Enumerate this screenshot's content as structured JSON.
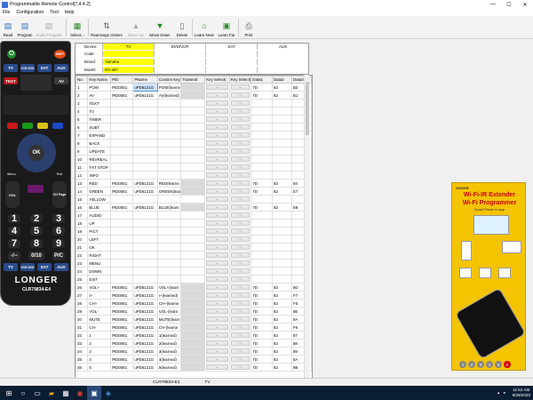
{
  "window": {
    "title": "Programmable Remote Control[7.4.4.2]",
    "minimize": "—",
    "maximize": "☐",
    "close": "✕"
  },
  "menu": [
    "File",
    "Configuration",
    "Tool",
    "Help"
  ],
  "toolbar": [
    {
      "label": "Read",
      "icon": "read-icon",
      "enabled": true
    },
    {
      "label": "Program",
      "icon": "program-icon",
      "enabled": true
    },
    {
      "label": "Audio Program",
      "icon": "audio-program-icon",
      "enabled": false
    },
    {
      "label": "Select...",
      "icon": "select-icon",
      "enabled": true
    },
    {
      "label": "Rearrange Orders",
      "icon": "rearrange-icon",
      "enabled": true
    },
    {
      "label": "Move Up",
      "icon": "move-up-icon",
      "enabled": false
    },
    {
      "label": "Move Down",
      "icon": "move-down-icon",
      "enabled": true
    },
    {
      "label": "Delete",
      "icon": "delete-icon",
      "enabled": true
    },
    {
      "label": "Learn Near",
      "icon": "learn-near-icon",
      "enabled": true
    },
    {
      "label": "Learn Far",
      "icon": "learn-far-icon",
      "enabled": true
    },
    {
      "label": "Print",
      "icon": "print-icon",
      "enabled": true
    }
  ],
  "remote": {
    "brand": "LONGER",
    "model": "CLR79834-E4",
    "top_row": [
      "TV",
      "VCR DVD",
      "SAT",
      "AUX"
    ],
    "row2": [
      "TEXT",
      "",
      "",
      "AV"
    ],
    "bottom_row": [
      "TV",
      "VCR DVD",
      "SAT",
      "AUX"
    ],
    "center": "OK",
    "menu": "Menu",
    "exit": "Exit",
    "vol": "VOL",
    "ch": "CH Page",
    "numbers": [
      "1",
      "2",
      "3",
      "4",
      "5",
      "6",
      "7",
      "8",
      "9",
      "-/--",
      "0/10",
      "P/C"
    ],
    "power": "⏻",
    "shift": "SHIFT"
  },
  "device": {
    "labels": [
      "Device:",
      "Code:",
      "Brand:",
      "Model:"
    ],
    "columns": [
      "TV",
      "DVD/VCR",
      "SAT",
      "AUX"
    ],
    "code": "",
    "brand": "Yamaha",
    "model": "RX-397"
  },
  "table": {
    "headers": [
      "No.",
      "Key Name",
      "PID",
      "PName",
      "Custom Key",
      "Transmit",
      "Key Select(",
      "Key Select(",
      "Data1",
      "Data2",
      "Data3"
    ],
    "rows": [
      [
        "1",
        "POW",
        "PID0051",
        "uPD6121G",
        "POW(learne",
        "",
        "...",
        "...",
        "7D",
        "82",
        "B2"
      ],
      [
        "2",
        "AV",
        "PID0051",
        "uPD6121G",
        "AV(learned)",
        "",
        "...",
        "...",
        "7D",
        "82",
        "B1"
      ],
      [
        "3",
        "TEXT",
        "",
        "",
        "",
        "",
        "...",
        "...",
        "",
        "",
        ""
      ],
      [
        "4",
        "TV",
        "",
        "",
        "",
        "",
        "...",
        "...",
        "",
        "",
        ""
      ],
      [
        "5",
        "TIMER",
        "",
        "",
        "",
        "",
        "...",
        "...",
        "",
        "",
        ""
      ],
      [
        "6",
        "SUBT",
        "",
        "",
        "",
        "",
        "...",
        "...",
        "",
        "",
        ""
      ],
      [
        "7",
        "EXPAND",
        "",
        "",
        "",
        "",
        "...",
        "...",
        "",
        "",
        ""
      ],
      [
        "8",
        "BACK",
        "",
        "",
        "",
        "",
        "...",
        "...",
        "",
        "",
        ""
      ],
      [
        "9",
        "UPDATE",
        "",
        "",
        "",
        "",
        "...",
        "...",
        "",
        "",
        ""
      ],
      [
        "10",
        "REVREAL",
        "",
        "",
        "",
        "",
        "...",
        "...",
        "",
        "",
        ""
      ],
      [
        "11",
        "TXT STOP",
        "",
        "",
        "",
        "",
        "...",
        "...",
        "",
        "",
        ""
      ],
      [
        "12",
        "INFO",
        "",
        "",
        "",
        "",
        "...",
        "...",
        "",
        "",
        ""
      ],
      [
        "13",
        "RED",
        "PID0051",
        "uPD6121G",
        "RED(learne",
        "",
        "...",
        "...",
        "7D",
        "82",
        "93"
      ],
      [
        "14",
        "GREEN",
        "PID0051",
        "uPD6121G",
        "GREEN(lear",
        "",
        "...",
        "...",
        "7D",
        "82",
        "E7"
      ],
      [
        "15",
        "YELLOW",
        "",
        "",
        "",
        "",
        "...",
        "...",
        "",
        "",
        ""
      ],
      [
        "16",
        "BLUE",
        "PID0051",
        "uPD6121G",
        "BLUE(learn",
        "",
        "...",
        "...",
        "7D",
        "82",
        "E8"
      ],
      [
        "17",
        "AUDIO",
        "",
        "",
        "",
        "",
        "...",
        "...",
        "",
        "",
        ""
      ],
      [
        "18",
        "UP",
        "",
        "",
        "",
        "",
        "...",
        "...",
        "",
        "",
        ""
      ],
      [
        "19",
        "PICT",
        "",
        "",
        "",
        "",
        "...",
        "...",
        "",
        "",
        ""
      ],
      [
        "20",
        "LEFT",
        "",
        "",
        "",
        "",
        "...",
        "...",
        "",
        "",
        ""
      ],
      [
        "21",
        "OK",
        "",
        "",
        "",
        "",
        "...",
        "...",
        "",
        "",
        ""
      ],
      [
        "22",
        "RIGHT",
        "",
        "",
        "",
        "",
        "...",
        "...",
        "",
        "",
        ""
      ],
      [
        "23",
        "MENU",
        "",
        "",
        "",
        "",
        "...",
        "...",
        "",
        "",
        ""
      ],
      [
        "24",
        "DOWN",
        "",
        "",
        "",
        "",
        "...",
        "...",
        "",
        "",
        ""
      ],
      [
        "25",
        "EXIT",
        "",
        "",
        "",
        "",
        "...",
        "...",
        "",
        "",
        ""
      ],
      [
        "26",
        "VOL+",
        "PID0051",
        "uPD6121G",
        "VOL+(learn",
        "",
        "...",
        "...",
        "7D",
        "82",
        "8D"
      ],
      [
        "27",
        "I+",
        "PID0051",
        "uPD6121G",
        "I+(learned)",
        "",
        "...",
        "...",
        "7D",
        "82",
        "F7"
      ],
      [
        "28",
        "CH+",
        "PID0051",
        "uPD6121G",
        "CH+(learne",
        "",
        "...",
        "...",
        "7D",
        "82",
        "F5"
      ],
      [
        "29",
        "VOL-",
        "PID0051",
        "uPD6121G",
        "VOL-(learn",
        "",
        "...",
        "...",
        "7D",
        "82",
        "8E"
      ],
      [
        "30",
        "MUTE",
        "PID0051",
        "uPD6121G",
        "MUTE(learn",
        "",
        "...",
        "...",
        "7D",
        "82",
        "9A"
      ],
      [
        "31",
        "CH-",
        "PID0051",
        "uPD6121G",
        "CH-(learne",
        "",
        "...",
        "...",
        "7D",
        "82",
        "F6"
      ],
      [
        "32",
        "1",
        "PID0051",
        "uPD6121G",
        "1(learned)",
        "",
        "...",
        "...",
        "7D",
        "82",
        "87"
      ],
      [
        "33",
        "2",
        "PID0051",
        "uPD6121G",
        "2(learned)",
        "",
        "...",
        "...",
        "7D",
        "82",
        "88"
      ],
      [
        "34",
        "3",
        "PID0051",
        "uPD6121G",
        "3(learned)",
        "",
        "...",
        "...",
        "7D",
        "82",
        "89"
      ],
      [
        "35",
        "4",
        "PID0051",
        "uPD6121G",
        "4(learned)",
        "",
        "...",
        "...",
        "7D",
        "82",
        "8A"
      ],
      [
        "36",
        "5",
        "PID0051",
        "uPD6121G",
        "5(learned)",
        "",
        "...",
        "...",
        "7D",
        "82",
        "8B"
      ]
    ]
  },
  "ad": {
    "brand": "ONGER",
    "headline1": "Wi-Fi-IR Extender",
    "headline2": "Wi-Fi Programmer",
    "subline": "Smart Phone to App",
    "pages": [
      "1",
      "2",
      "3",
      "4",
      "5",
      "6"
    ],
    "active_page": 6
  },
  "status": {
    "model": "CLR79834-E4",
    "device": "TV"
  },
  "taskbar": {
    "time": "11:52 AM",
    "date": "8/29/2020"
  }
}
